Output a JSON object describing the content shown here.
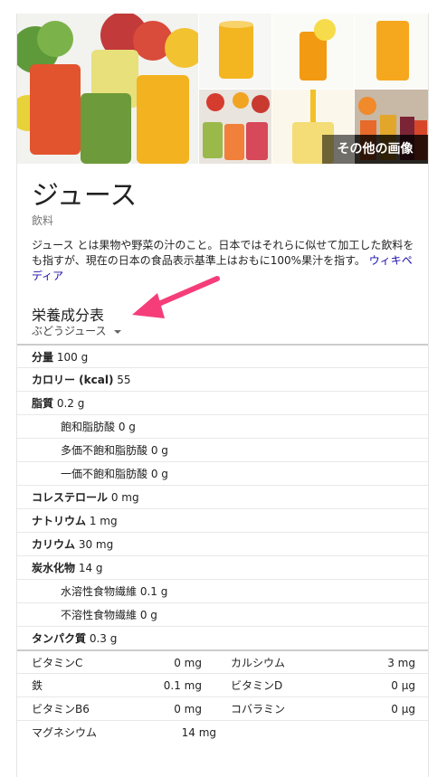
{
  "images": {
    "more_label": "その他の画像"
  },
  "entity": {
    "title": "ジュース",
    "subtitle": "飲料",
    "description": "ジュース とは果物や野菜の汁のこと。日本ではそれらに似せて加工した飲料をも指すが、現在の日本の食品表示基準上はおもに100%果汁を指す。",
    "source_link": "ウィキペディア"
  },
  "nutrition": {
    "title": "栄養成分表",
    "selected": "ぶどうジュース",
    "rows": [
      {
        "label": "分量",
        "value": "100 g",
        "indent": false
      },
      {
        "label": "カロリー (kcal)",
        "value": "55",
        "indent": false
      },
      {
        "label": "脂質",
        "value": "0.2 g",
        "indent": false
      },
      {
        "label": "飽和脂肪酸",
        "value": "0 g",
        "indent": true
      },
      {
        "label": "多価不飽和脂肪酸",
        "value": "0 g",
        "indent": true
      },
      {
        "label": "一価不飽和脂肪酸",
        "value": "0 g",
        "indent": true
      },
      {
        "label": "コレステロール",
        "value": "0 mg",
        "indent": false
      },
      {
        "label": "ナトリウム",
        "value": "1 mg",
        "indent": false
      },
      {
        "label": "カリウム",
        "value": "30 mg",
        "indent": false
      },
      {
        "label": "炭水化物",
        "value": "14 g",
        "indent": false
      },
      {
        "label": "水溶性食物繊維",
        "value": "0.1 g",
        "indent": true
      },
      {
        "label": "不溶性食物繊維",
        "value": "0 g",
        "indent": true
      },
      {
        "label": "タンパク質",
        "value": "0.3 g",
        "indent": false
      }
    ],
    "vitamins": [
      [
        {
          "label": "ビタミンC",
          "value": "0 mg"
        },
        {
          "label": "カルシウム",
          "value": "3 mg"
        }
      ],
      [
        {
          "label": "鉄",
          "value": "0.1 mg"
        },
        {
          "label": "ビタミンD",
          "value": "0 µg"
        }
      ],
      [
        {
          "label": "ビタミンB6",
          "value": "0 mg"
        },
        {
          "label": "コバラミン",
          "value": "0 µg"
        }
      ],
      [
        {
          "label": "マグネシウム",
          "value": "14 mg"
        }
      ]
    ]
  }
}
